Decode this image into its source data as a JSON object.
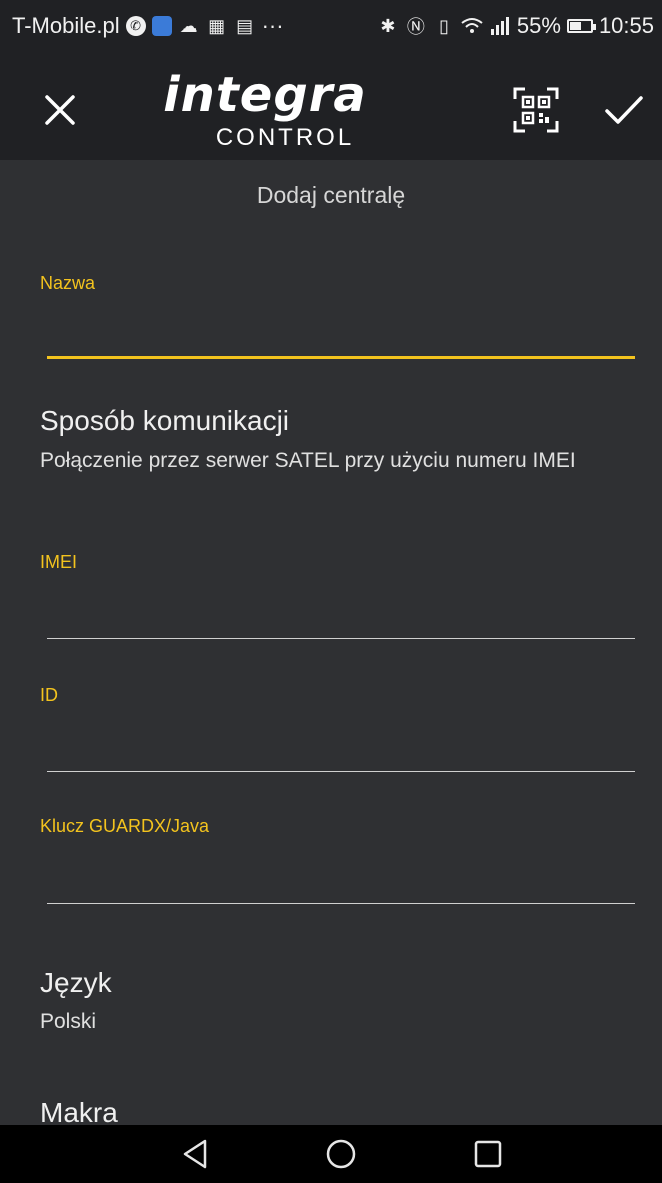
{
  "status_bar": {
    "carrier": "T-Mobile.pl",
    "ellipsis": "···",
    "signal_text": "55%",
    "time": "10:55",
    "battery_level": 0.55,
    "icons": [
      "app-icon",
      "messenger-icon",
      "cloud-icon",
      "calculator-icon",
      "message-icon",
      "bluetooth-icon",
      "nfc-icon",
      "vibrate-icon",
      "wifi-icon",
      "signal-icon",
      "battery-icon"
    ]
  },
  "toolbar": {
    "logo_main": "integra",
    "logo_sub": "CONTROL",
    "icons": [
      "close-icon",
      "qr-code-icon",
      "checkmark-icon"
    ]
  },
  "form": {
    "title": "Dodaj centralę",
    "name_label": "Nazwa",
    "name_value": "",
    "comm_title": "Sposób komunikacji",
    "comm_value": "Połączenie przez serwer SATEL przy użyciu numeru IMEI",
    "imei_label": "IMEI",
    "imei_value": "",
    "id_label": "ID",
    "id_value": "",
    "key_label": "Klucz GUARDX/Java",
    "key_value": "",
    "lang_title": "Język",
    "lang_value": "Polski",
    "macro_title": "Makra"
  },
  "navbar": {
    "icons": [
      "back-icon",
      "home-icon",
      "recents-icon"
    ]
  },
  "colors": {
    "accent": "#f3c31e",
    "background": "#2f3033",
    "bar": "#202124",
    "navbar": "#000000"
  }
}
